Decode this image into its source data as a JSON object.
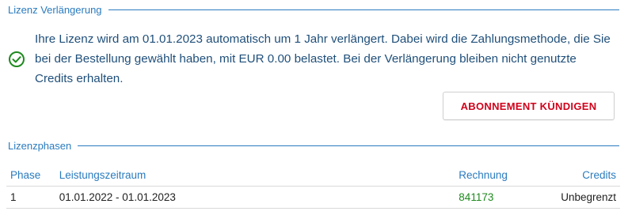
{
  "section_renewal": {
    "legend": "Lizenz Verlängerung",
    "message": "Ihre Lizenz wird am 01.01.2023 automatisch um 1 Jahr verlängert. Dabei wird die Zahlungsmethode, die Sie bei der Bestellung gewählt haben, mit EUR 0.00 belastet. Bei der Verlängerung bleiben nicht genutzte Credits erhalten.",
    "icon": "check-circle-icon",
    "cancel_button": "ABONNEMENT KÜNDIGEN"
  },
  "section_phases": {
    "legend": "Lizenzphasen",
    "columns": {
      "phase": "Phase",
      "period": "Leistungszeitraum",
      "invoice": "Rechnung",
      "credits": "Credits"
    },
    "rows": [
      {
        "phase": "1",
        "period": "01.01.2022 - 01.01.2023",
        "invoice": "841173",
        "credits": "Unbegrenzt"
      }
    ]
  },
  "colors": {
    "accent": "#2a7bbf",
    "message_text": "#1f4f7a",
    "success": "#1e8a1e",
    "danger": "#d0021b"
  }
}
